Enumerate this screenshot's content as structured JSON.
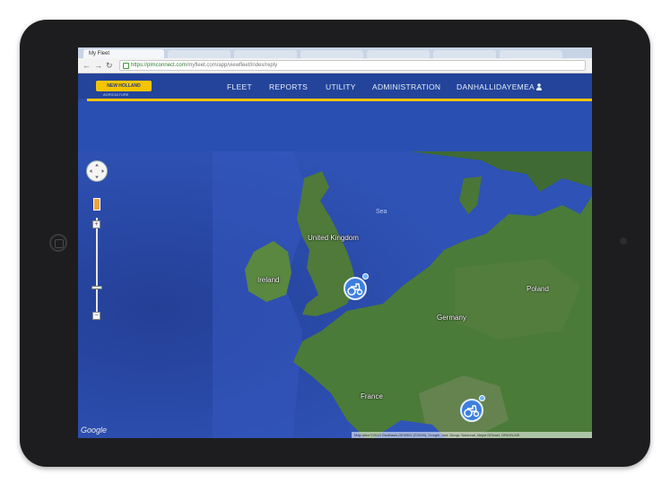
{
  "browser": {
    "tab_title": "My Fleet",
    "url_host": "https://plmconnect.com",
    "url_path": "/myfleet.com/app/viewfleet/index/reply",
    "back_icon": "back-arrow-icon",
    "forward_icon": "forward-arrow-icon",
    "reload_icon": "reload-icon"
  },
  "app": {
    "logo_text": "NEW HOLLAND",
    "logo_sub": "AGRICULTURE",
    "nav": {
      "fleet": "FLEET",
      "reports": "REPORTS",
      "utility": "UTILITY",
      "administration": "ADMINISTRATION",
      "user": "DANHALLIDAYEMEA"
    },
    "user_icon": "user-icon",
    "colors": {
      "header": "#23449a",
      "accent": "#f5c400",
      "marker": "#3c7fe0"
    }
  },
  "map": {
    "labels": {
      "uk": "United Kingdom",
      "ireland": "Ireland",
      "germany": "Germany",
      "poland": "Poland",
      "france": "France",
      "sea": "Sea"
    },
    "google": "Google",
    "attribution": "Map data ©2013 GeoBasis-DE/BKG (©2009), Google, Inst. Geogr. Nacional, Mapa GISrael, ORION-ME",
    "markers": [
      {
        "name": "machine-marker-uk",
        "icon": "tractor-icon"
      },
      {
        "name": "machine-marker-italy",
        "icon": "tractor-icon"
      }
    ]
  }
}
